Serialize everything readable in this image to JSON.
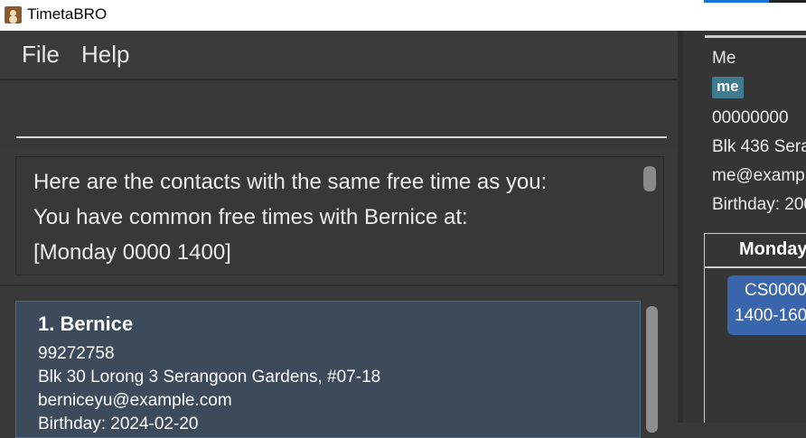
{
  "window": {
    "title": "TimetaBRO"
  },
  "menu": {
    "file_label": "File",
    "help_label": "Help"
  },
  "command": {
    "value": ""
  },
  "result": {
    "lines": [
      "Here are the contacts with the same free time as you:",
      "You have common free times with Bernice at:",
      "[Monday 0000 1400]"
    ]
  },
  "contacts": [
    {
      "index": "1.",
      "name": "Bernice",
      "phone": "99272758",
      "address": "Blk 30 Lorong 3 Serangoon Gardens, #07-18",
      "email": "berniceyu@example.com",
      "birthday": "Birthday: 2024-02-20"
    }
  ],
  "me": {
    "name": "Me",
    "tag": "me",
    "phone": "00000000",
    "address": "Blk 436 Sera",
    "email": "me@examp",
    "birthday": "Birthday: 200"
  },
  "calendar": {
    "day": "Monday",
    "event": {
      "module": "CS0000",
      "time": "1400-160"
    }
  },
  "colors": {
    "card_bg": "#3d4a5c",
    "tag_bg": "#3e7b91",
    "event_bg": "#3a66ad",
    "title_accent": "#1a73d9"
  }
}
